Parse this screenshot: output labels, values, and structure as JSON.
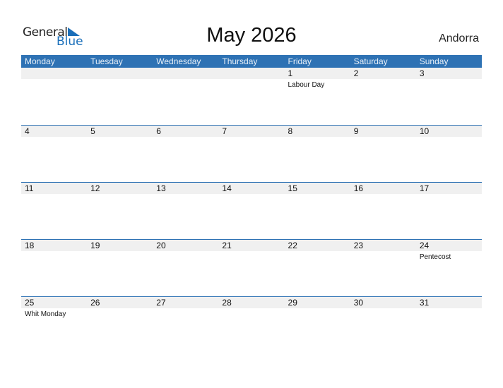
{
  "brand": {
    "line1": "General",
    "line2": "Blue"
  },
  "title": "May 2026",
  "country": "Andorra",
  "colors": {
    "accent": "#2e72b4",
    "band": "#f0f0f0"
  },
  "weekdays": [
    "Monday",
    "Tuesday",
    "Wednesday",
    "Thursday",
    "Friday",
    "Saturday",
    "Sunday"
  ],
  "weeks": [
    [
      {
        "d": ""
      },
      {
        "d": ""
      },
      {
        "d": ""
      },
      {
        "d": ""
      },
      {
        "d": "1",
        "h": "Labour Day"
      },
      {
        "d": "2"
      },
      {
        "d": "3"
      }
    ],
    [
      {
        "d": "4"
      },
      {
        "d": "5"
      },
      {
        "d": "6"
      },
      {
        "d": "7"
      },
      {
        "d": "8"
      },
      {
        "d": "9"
      },
      {
        "d": "10"
      }
    ],
    [
      {
        "d": "11"
      },
      {
        "d": "12"
      },
      {
        "d": "13"
      },
      {
        "d": "14"
      },
      {
        "d": "15"
      },
      {
        "d": "16"
      },
      {
        "d": "17"
      }
    ],
    [
      {
        "d": "18"
      },
      {
        "d": "19"
      },
      {
        "d": "20"
      },
      {
        "d": "21"
      },
      {
        "d": "22"
      },
      {
        "d": "23"
      },
      {
        "d": "24",
        "h": "Pentecost"
      }
    ],
    [
      {
        "d": "25",
        "h": "Whit Monday"
      },
      {
        "d": "26"
      },
      {
        "d": "27"
      },
      {
        "d": "28"
      },
      {
        "d": "29"
      },
      {
        "d": "30"
      },
      {
        "d": "31"
      }
    ]
  ]
}
